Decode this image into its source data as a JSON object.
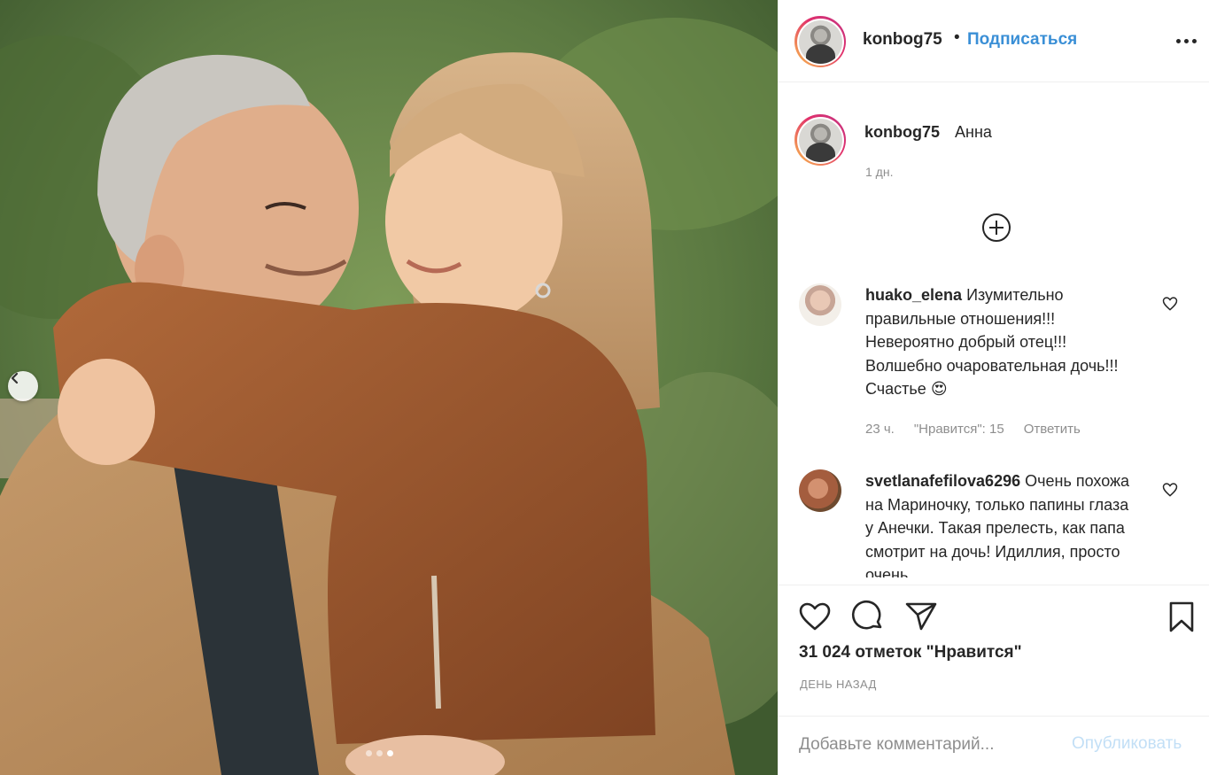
{
  "post": {
    "author": "konbog75",
    "separator": "•",
    "follow_label": "Подписаться",
    "photo_alt_count": 3,
    "active_photo_index": 0
  },
  "caption": {
    "username": "konbog75",
    "text": "Анна",
    "time": "1 дн."
  },
  "comments": [
    {
      "username": "huako_elena",
      "text": "Изумительно правильные отношения!!! Невероятно добрый отец!!! Волшебно очаровательная дочь!!! Счастье 😍",
      "time": "23 ч.",
      "likes": "\"Нравится\": 15",
      "reply": "Ответить"
    },
    {
      "username": "svetlanafefilova6296",
      "text": "Очень похожа на Мариночку, только папины глаза у Анечки. Такая прелесть, как папа смотрит на дочь! Идиллия, просто очень",
      "time": "",
      "likes": "",
      "reply": ""
    }
  ],
  "stats": {
    "likes": "31 024 отметок \"Нравится\"",
    "posted": "ДЕНЬ НАЗАД"
  },
  "composer": {
    "placeholder": "Добавьте комментарий...",
    "publish_label": "Опубликовать"
  },
  "icons": {
    "more": "more-options-icon",
    "prev": "chevron-left-icon",
    "load_more": "plus-circle-icon",
    "like": "heart-icon",
    "comment": "comment-bubble-icon",
    "share": "paper-plane-icon",
    "save": "bookmark-icon"
  },
  "colors": {
    "link": "#3a8fd6",
    "publish_disabled": "#c2dff6",
    "muted": "#8e8e8e",
    "text": "#262626"
  }
}
